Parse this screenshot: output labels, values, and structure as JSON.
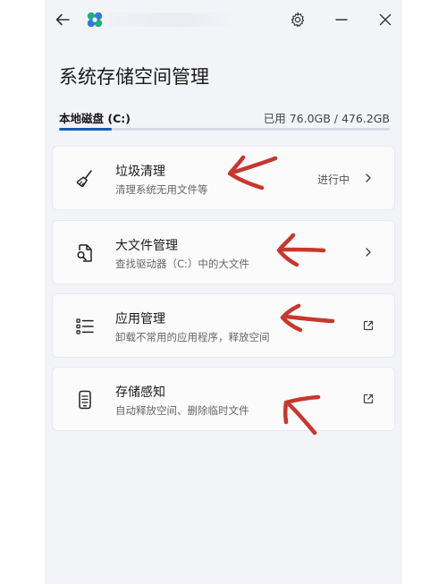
{
  "header": {
    "back_icon": "back-arrow-icon",
    "settings_icon": "gear-icon",
    "minimize_icon": "minimize-icon",
    "close_icon": "close-icon"
  },
  "page": {
    "title": "系统存储空间管理"
  },
  "drive": {
    "name": "本地磁盘 (C:)",
    "usage_text": "已用 76.0GB / 476.2GB",
    "used_fraction": 0.16
  },
  "cards": [
    {
      "icon": "broom-icon",
      "title": "垃圾清理",
      "subtitle": "清理系统无用文件等",
      "status": "进行中",
      "action_icon": "chevron-right-icon"
    },
    {
      "icon": "file-search-icon",
      "title": "大文件管理",
      "subtitle": "查找驱动器（C:）中的大文件",
      "status": "",
      "action_icon": "chevron-right-icon"
    },
    {
      "icon": "list-icon",
      "title": "应用管理",
      "subtitle": "卸载不常用的应用程序，释放空间",
      "status": "",
      "action_icon": "external-link-icon"
    },
    {
      "icon": "phone-storage-icon",
      "title": "存储感知",
      "subtitle": "自动释放空间、删除临时文件",
      "status": "",
      "action_icon": "external-link-icon"
    }
  ],
  "colors": {
    "accent": "#0a5db8",
    "annotation_arrow": "#c8372d"
  }
}
